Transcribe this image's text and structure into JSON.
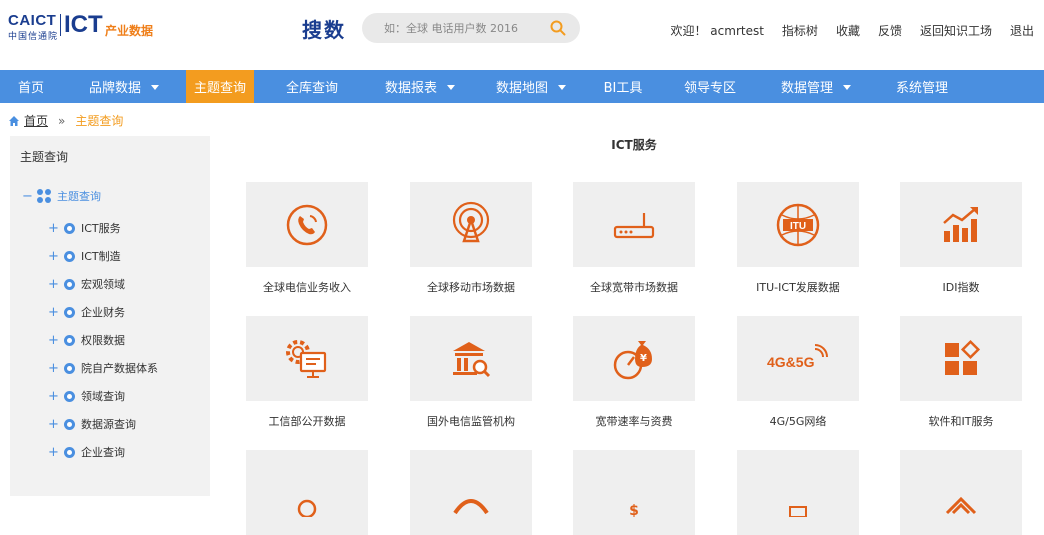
{
  "logo": {
    "caict": "CAICT",
    "cn": "中国信通院",
    "ict": "ICT",
    "ict_sub": "产业数据"
  },
  "search": {
    "title": "搜数",
    "placeholder": "如：全球 电话用户数 2016",
    "icon": "search-icon"
  },
  "top_links": [
    "欢迎！ acmrtest",
    "指标树",
    "收藏",
    "反馈",
    "返回知识工场",
    "退出"
  ],
  "nav": [
    {
      "label": "首页",
      "dropdown": false,
      "active": false
    },
    {
      "label": "品牌数据",
      "dropdown": true,
      "active": false
    },
    {
      "label": "主题查询",
      "dropdown": false,
      "active": true
    },
    {
      "label": "全库查询",
      "dropdown": false,
      "active": false
    },
    {
      "label": "数据报表",
      "dropdown": true,
      "active": false
    },
    {
      "label": "数据地图",
      "dropdown": true,
      "active": false
    },
    {
      "label": "BI工具",
      "dropdown": false,
      "active": false
    },
    {
      "label": "领导专区",
      "dropdown": false,
      "active": false
    },
    {
      "label": "数据管理",
      "dropdown": true,
      "active": false
    },
    {
      "label": "系统管理",
      "dropdown": false,
      "active": false
    }
  ],
  "breadcrumb": {
    "home": "首页",
    "current": "主题查询"
  },
  "sidebar": {
    "title": "主题查询",
    "root": "主题查询",
    "items": [
      "ICT服务",
      "ICT制造",
      "宏观领域",
      "企业财务",
      "权限数据",
      "院自产数据体系",
      "领域查询",
      "数据源查询",
      "企业查询"
    ]
  },
  "main": {
    "title": "ICT服务",
    "cards": [
      {
        "label": "全球电信业务收入",
        "icon": "phone-icon"
      },
      {
        "label": "全球移动市场数据",
        "icon": "antenna-icon"
      },
      {
        "label": "全球宽带市场数据",
        "icon": "router-icon"
      },
      {
        "label": "ITU-ICT发展数据",
        "icon": "itu-icon"
      },
      {
        "label": "IDI指数",
        "icon": "bar-chart-icon"
      },
      {
        "label": "工信部公开数据",
        "icon": "monitor-gear-icon"
      },
      {
        "label": "国外电信监管机构",
        "icon": "building-search-icon"
      },
      {
        "label": "宽带速率与资费",
        "icon": "speed-money-icon"
      },
      {
        "label": "4G/5G网络",
        "icon": "4g5g-icon",
        "icon_text": "4G&5G"
      },
      {
        "label": "软件和IT服务",
        "icon": "blocks-icon"
      }
    ]
  },
  "colors": {
    "accent": "#e0601a",
    "nav": "#4a8fe0",
    "active": "#f39c1f",
    "brand": "#1a3d8f"
  }
}
